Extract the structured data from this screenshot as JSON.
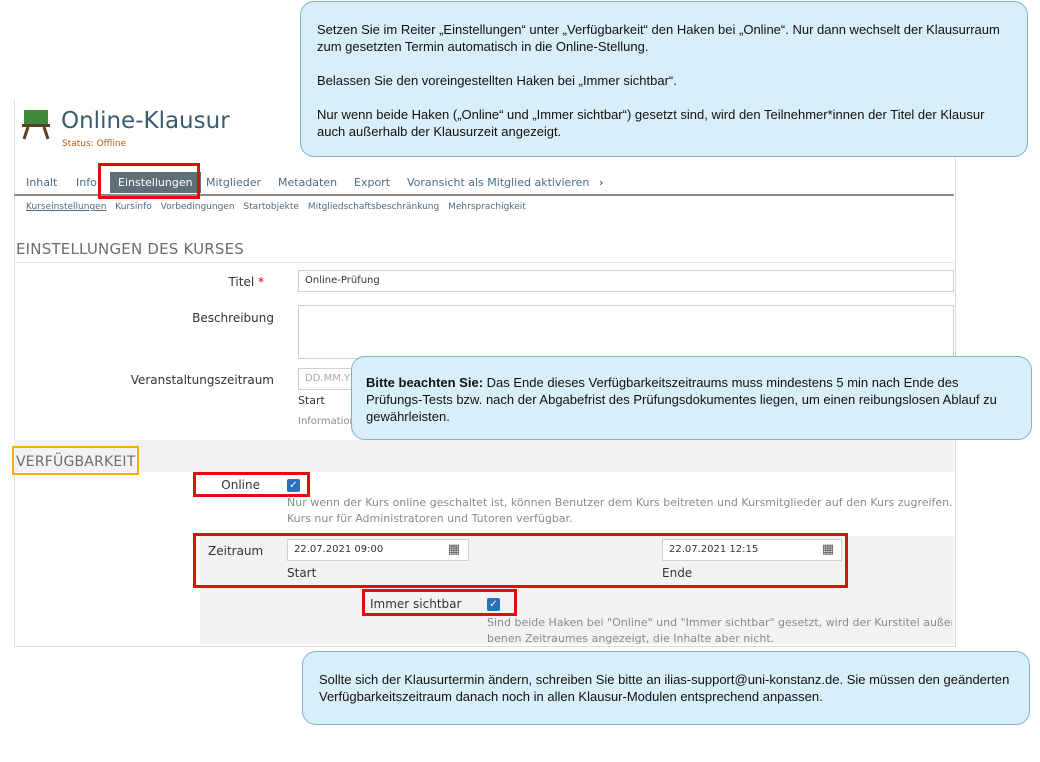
{
  "header": {
    "title": "Online-Klausur",
    "status": "Status: Offline"
  },
  "tabs": [
    {
      "label": "Inhalt"
    },
    {
      "label": "Info"
    },
    {
      "label": "Einstellungen"
    },
    {
      "label": "Mitglieder"
    },
    {
      "label": "Metadaten"
    },
    {
      "label": "Export"
    },
    {
      "label": "Voransicht als Mitglied aktivieren"
    }
  ],
  "subtabs": [
    {
      "label": "Kurseinstellungen"
    },
    {
      "label": "Kursinfo"
    },
    {
      "label": "Vorbedingungen"
    },
    {
      "label": "Startobjekte"
    },
    {
      "label": "Mitgliedschaftsbeschränkung"
    },
    {
      "label": "Mehrsprachigkeit"
    }
  ],
  "course_settings": {
    "section_title": "EINSTELLUNGEN DES KURSES",
    "title_label": "Titel",
    "required_mark": "*",
    "title_value": "Online-Prüfung",
    "description_label": "Beschreibung",
    "period_label": "Veranstaltungszeitraum",
    "period_placeholder": "DD.MM.YY",
    "period_start_label": "Start",
    "period_info": "Information"
  },
  "availability": {
    "section_title": "VERFÜGBARKEIT",
    "online_label": "Online",
    "online_checked": true,
    "online_help_line1": "Nur wenn der Kurs online geschaltet ist, können Benutzer dem Kurs beitreten und Kursmitglieder auf den Kurs zugreifen. Wenn",
    "online_help_line2": "Kurs nur für Administratoren und Tutoren verfügbar.",
    "period_label": "Zeitraum",
    "start_value": "22.07.2021 09:00",
    "start_label": "Start",
    "end_value": "22.07.2021 12:15",
    "end_label": "Ende",
    "always_visible_label": "Immer sichtbar",
    "always_visible_checked": true,
    "visible_help_line1": "Sind beide Haken bei \"Online\" und \"Immer sichtbar\" gesetzt, wird der Kurstitel außerhalb",
    "visible_help_line2": "benen Zeitraumes angezeigt, die Inhalte aber nicht."
  },
  "callouts": {
    "top_p1": "Setzen Sie im Reiter „Einstellungen“ unter „Verfügbarkeit“ den Haken bei „Online“. Nur dann wechselt der Klausurraum zum gesetzten Termin automatisch in die Online-Stellung.",
    "top_p2": "Belassen Sie den voreingestellten Haken bei „Immer sichtbar“.",
    "top_p3": "Nur wenn beide Haken („Online“ und „Immer sichtbar“) gesetzt sind, wird den Teilnehmer*innen der Titel der Klausur auch außerhalb der Klausurzeit angezeigt.",
    "middle_bold": "Bitte beachten Sie:",
    "middle_text": " Das Ende dieses Verfügbarkeitszeitraums muss mindestens 5 min nach Ende des Prüfungs-Tests bzw. nach der Abgabefrist des Prüfungsdokumentes liegen, um einen reibungslosen Ablauf zu gewährleisten.",
    "bottom": "Sollte sich der Klausurtermin ändern, schreiben Sie bitte an ilias-support@uni-konstanz.de. Sie müssen den geänderten Verfügbarkeitszeitraum danach noch in allen Klausur-Modulen entsprechend anpassen."
  },
  "colors": {
    "highlight_red": "#e50b0b",
    "highlight_yellow": "#f2b000",
    "callout_bg": "#d8eef8",
    "checkbox_blue": "#2d6fb8"
  }
}
